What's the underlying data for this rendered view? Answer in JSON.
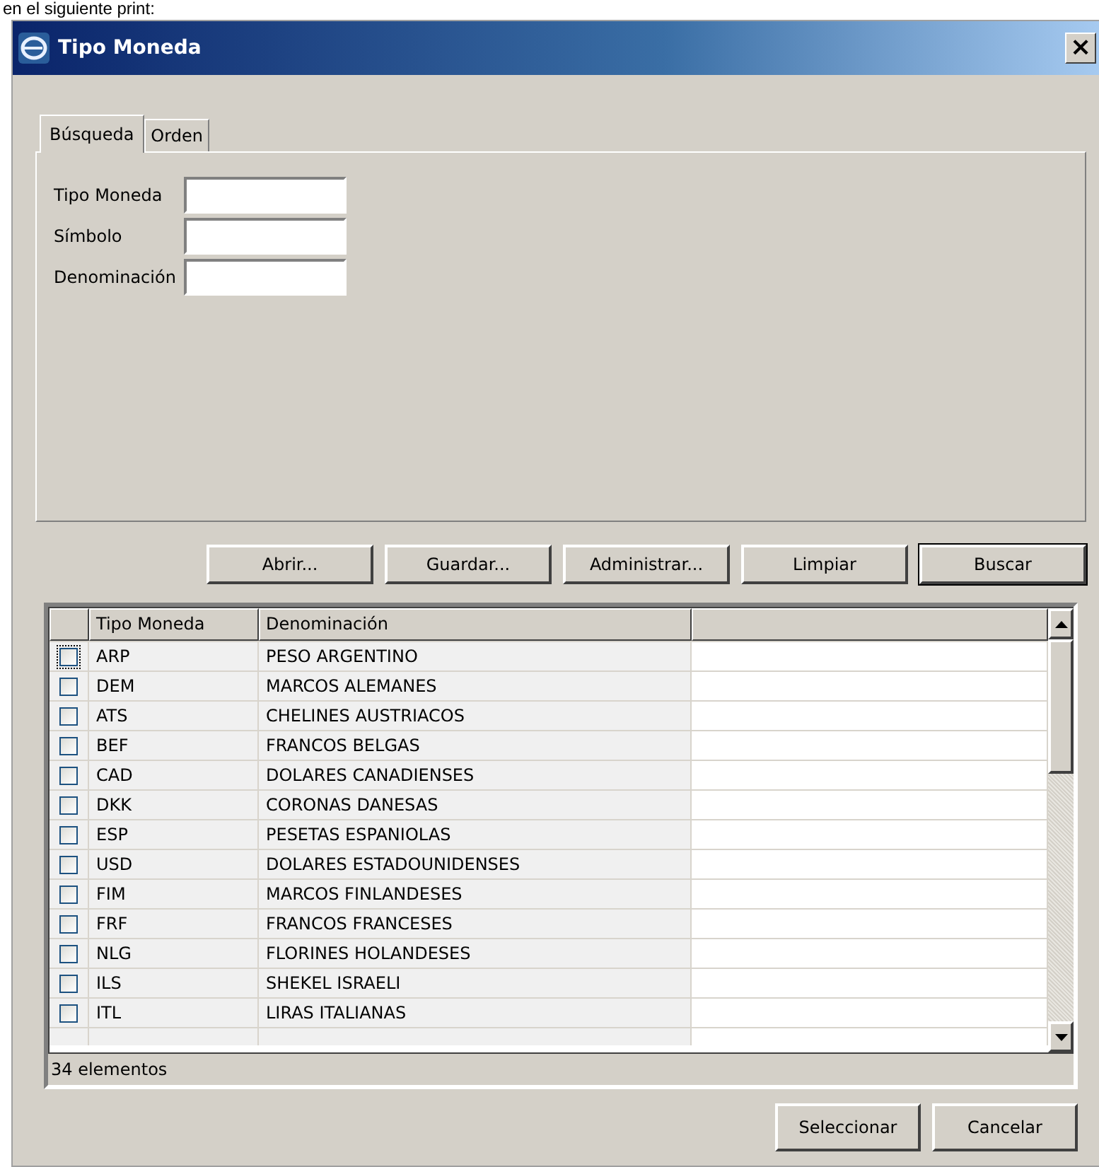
{
  "caption": "en el siguiente print:",
  "window": {
    "title": "Tipo Moneda",
    "close": "×"
  },
  "tabs": [
    {
      "label": "Búsqueda",
      "selected": true
    },
    {
      "label": "Orden",
      "selected": false
    }
  ],
  "fields": [
    {
      "label": "Tipo Moneda"
    },
    {
      "label": "Símbolo"
    },
    {
      "label": "Denominación"
    }
  ],
  "buttons": [
    {
      "label": "Abrir...",
      "default": false
    },
    {
      "label": "Guardar...",
      "default": false
    },
    {
      "label": "Administrar...",
      "default": false
    },
    {
      "label": "Limpiar",
      "default": false
    },
    {
      "label": "Buscar",
      "default": true
    }
  ],
  "table": {
    "columns": [
      "Tipo Moneda",
      "Denominación"
    ],
    "rows": [
      {
        "code": "ARP",
        "name": "PESO ARGENTINO",
        "checked": false,
        "focused": true
      },
      {
        "code": "DEM",
        "name": "MARCOS ALEMANES",
        "checked": false,
        "focused": false
      },
      {
        "code": "ATS",
        "name": "CHELINES AUSTRIACOS",
        "checked": false,
        "focused": false
      },
      {
        "code": "BEF",
        "name": "FRANCOS BELGAS",
        "checked": false,
        "focused": false
      },
      {
        "code": "CAD",
        "name": "DOLARES CANADIENSES",
        "checked": false,
        "focused": false
      },
      {
        "code": "DKK",
        "name": "CORONAS DANESAS",
        "checked": false,
        "focused": false
      },
      {
        "code": "ESP",
        "name": "PESETAS ESPANIOLAS",
        "checked": false,
        "focused": false
      },
      {
        "code": "USD",
        "name": "DOLARES ESTADOUNIDENSES",
        "checked": false,
        "focused": false
      },
      {
        "code": "FIM",
        "name": "MARCOS FINLANDESES",
        "checked": false,
        "focused": false
      },
      {
        "code": "FRF",
        "name": "FRANCOS FRANCESES",
        "checked": false,
        "focused": false
      },
      {
        "code": "NLG",
        "name": "FLORINES HOLANDESES",
        "checked": false,
        "focused": false
      },
      {
        "code": "ILS",
        "name": "SHEKEL ISRAELI",
        "checked": false,
        "focused": false
      },
      {
        "code": "ITL",
        "name": "LIRAS ITALIANAS",
        "checked": false,
        "focused": false
      }
    ],
    "count": "34 elementos"
  },
  "footer_buttons": [
    {
      "label": "Seleccionar"
    },
    {
      "label": "Cancelar"
    }
  ]
}
